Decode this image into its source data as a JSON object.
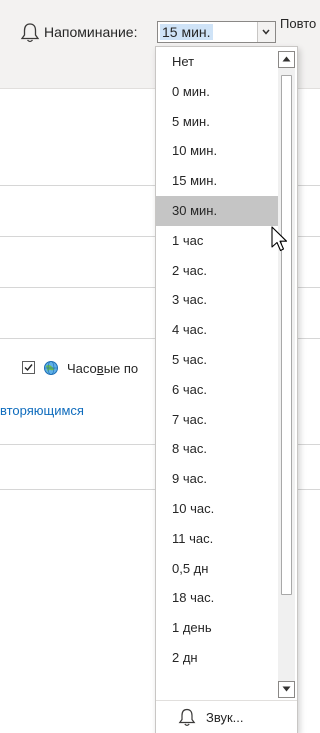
{
  "ribbon": {
    "reminder_label": "Напоминание:",
    "reminder_value": "15 мин.",
    "repeat_label": "Повто"
  },
  "dropdown": {
    "options": [
      "Нет",
      "0 мин.",
      "5 мин.",
      "10 мин.",
      "15 мин.",
      "30 мин.",
      "1 час",
      "2 час.",
      "3 час.",
      "4 час.",
      "5 час.",
      "6 час.",
      "7 час.",
      "8 час.",
      "9 час.",
      "10 час.",
      "11 час.",
      "0,5 дн",
      "18 час.",
      "1 день",
      "2 дн"
    ],
    "highlighted": "30 мин.",
    "sound_label": "Звук..."
  },
  "body": {
    "timezone_label_pre": "Часо",
    "timezone_label_underlined": "в",
    "timezone_label_post": "ые по",
    "timezone_checked": true,
    "recurring_link": "вторяющимся"
  }
}
